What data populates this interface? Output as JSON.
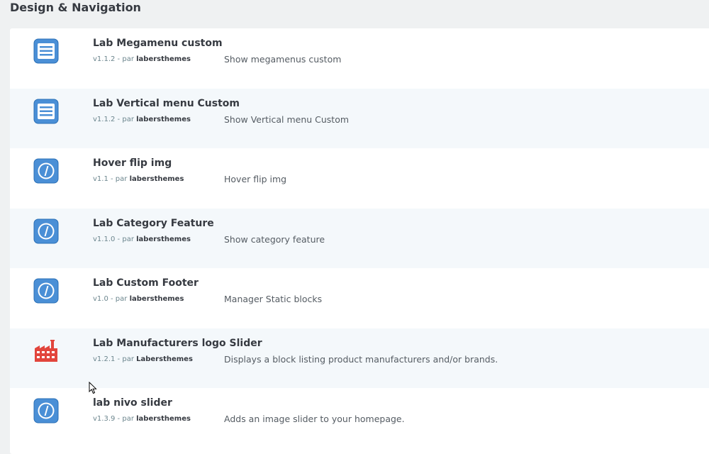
{
  "section": {
    "title": "Design & Navigation"
  },
  "modules": [
    {
      "name": "Lab Megamenu custom",
      "version": "v1.1.2",
      "by": "par",
      "author": "labersthemes",
      "description": "Show megamenus custom",
      "icon": "list-icon"
    },
    {
      "name": "Lab Vertical menu Custom",
      "version": "v1.1.2",
      "by": "par",
      "author": "labersthemes",
      "description": "Show Vertical menu Custom",
      "icon": "list-icon"
    },
    {
      "name": "Hover flip img",
      "version": "v1.1",
      "by": "par",
      "author": "labersthemes",
      "description": "Hover flip img",
      "icon": "info-icon"
    },
    {
      "name": "Lab Category Feature",
      "version": "v1.1.0",
      "by": "par",
      "author": "labersthemes",
      "description": "Show category feature",
      "icon": "info-icon"
    },
    {
      "name": "Lab Custom Footer",
      "version": "v1.0",
      "by": "par",
      "author": "labersthemes",
      "description": "Manager Static blocks",
      "icon": "info-icon"
    },
    {
      "name": "Lab Manufacturers logo Slider",
      "version": "v1.2.1",
      "by": "par",
      "author": "Labersthemes",
      "description": "Displays a block listing product manufacturers and/or brands.",
      "icon": "factory-icon"
    },
    {
      "name": "lab nivo slider",
      "version": "v1.3.9",
      "by": "par",
      "author": "labersthemes",
      "description": "Adds an image slider to your homepage.",
      "icon": "info-icon"
    }
  ],
  "colors": {
    "icon_blue": "#4a8fd6",
    "icon_blue_dark": "#2a6fb5",
    "factory_red": "#e2453c"
  }
}
